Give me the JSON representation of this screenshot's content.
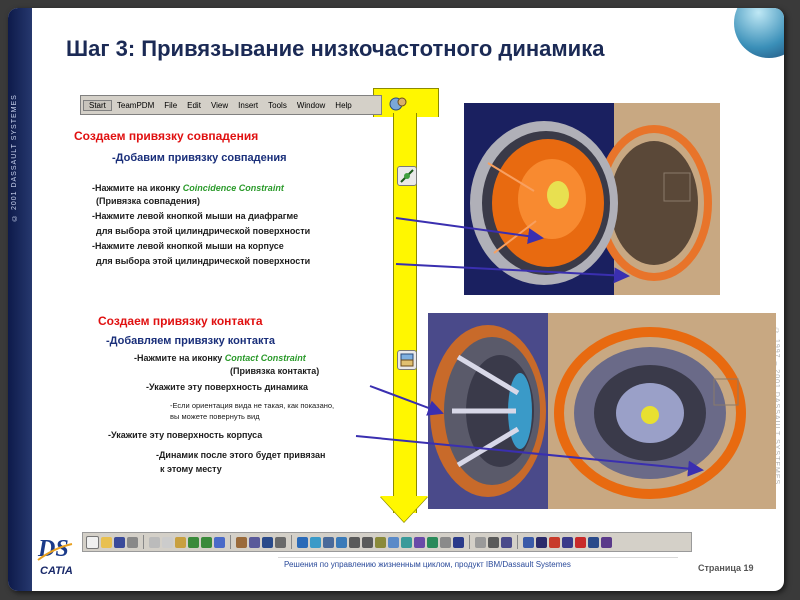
{
  "slide": {
    "title": "Шаг 3: Привязывание низкочастотного динамика",
    "left_band_text": "© 2001 DASSAULT SYSTEMES",
    "right_band_text": "© 1997 – 2001 DASSAULT SYSTEMES",
    "footer_text": "Решения по управлению жизненным циклом, продукт IBM/Dassault Systemes",
    "page_number": "Страница 19"
  },
  "menubar": {
    "items": [
      "Start",
      "TeamPDM",
      "File",
      "Edit",
      "View",
      "Insert",
      "Tools",
      "Window",
      "Help"
    ]
  },
  "section1": {
    "heading": "Создаем привязку совпадения",
    "subheading": "-Добавим привязку совпадения",
    "line1_prefix": "-Нажмите на иконку ",
    "line1_link": "Coincidence Constraint",
    "line2": "(Привязка совпадения)",
    "line3": "-Нажмите левой кнопкой мыши на диафрагме",
    "line4": "для выбора этой цилиндрической поверхности",
    "line5": "-Нажмите левой кнопкой мыши на корпусе",
    "line6": "для выбора этой цилиндрической поверхности"
  },
  "section2": {
    "heading": "Создаем привязку контакта",
    "subheading": "-Добавляем привязку контакта",
    "line1_prefix": "-Нажмите на иконку ",
    "line1_link": "Contact Constraint",
    "line2": "(Привязка контакта)",
    "line3": "-Укажите эту поверхность динамика",
    "note1": "-Если ориентация вида не такая, как показано,",
    "note2": "вы можете повернуть вид",
    "line4": "-Укажите эту поверхность корпуса",
    "line5": "-Динамик после этого будет привязан",
    "line6": "к этому месту"
  },
  "logo": {
    "text": "CATIA",
    "mark": "DS"
  },
  "colors": {
    "heading_red": "#e01010",
    "heading_blue": "#1a2f7a",
    "link_green": "#2a9a2a",
    "arrow_yellow": "#fff700",
    "pointer_blue": "#3a2fb0"
  }
}
